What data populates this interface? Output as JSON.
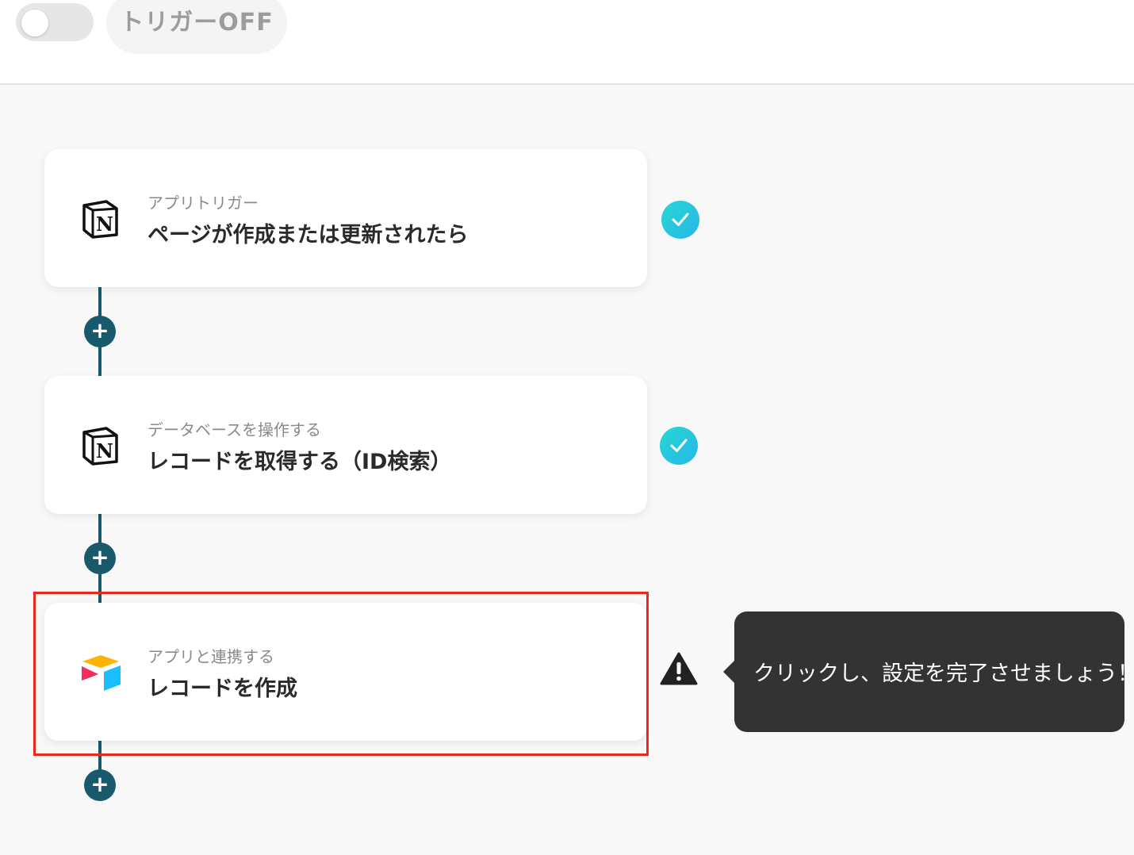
{
  "header": {
    "toggle_state": "off",
    "trigger_status_label": "トリガーOFF"
  },
  "flow": {
    "steps": [
      {
        "subtitle": "アプリトリガー",
        "title": "ページが作成または更新されたら",
        "app_icon": "notion-icon",
        "status": "completed",
        "status_icon": "check-circle-icon"
      },
      {
        "subtitle": "データベースを操作する",
        "title": "レコードを取得する（ID検索）",
        "app_icon": "notion-icon",
        "status": "completed",
        "status_icon": "check-circle-icon"
      },
      {
        "subtitle": "アプリと連携する",
        "title": "レコードを作成",
        "app_icon": "airtable-icon",
        "status": "incomplete",
        "status_icon": "warning-icon"
      }
    ],
    "add_step_buttons": [
      "+",
      "+",
      "+"
    ]
  },
  "tooltip": {
    "text": "クリックし、設定を完了させましょう！"
  },
  "colors": {
    "connector": "#18596b",
    "check_gradient_start": "#27d8d4",
    "check_gradient_end": "#27b6e8",
    "highlight_border": "#e8291c",
    "tooltip_bg": "#333333"
  }
}
